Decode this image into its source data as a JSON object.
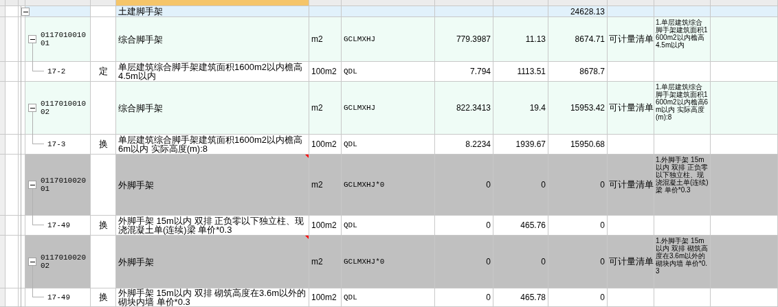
{
  "header_cells": [
    {
      "selected": false
    },
    {
      "selected": false
    },
    {
      "selected": false
    },
    {
      "selected": false
    },
    {
      "selected": false
    },
    {
      "selected": true
    },
    {
      "selected": false
    },
    {
      "selected": false
    },
    {
      "selected": false
    },
    {
      "selected": false
    },
    {
      "selected": false
    },
    {
      "selected": false
    },
    {
      "selected": false
    },
    {
      "selected": false
    }
  ],
  "rows": [
    {
      "kind": "section",
      "greyed": false,
      "flagged": false,
      "expanded": true,
      "code": "",
      "type": "",
      "name": "土建脚手架",
      "unit": "",
      "expr": "",
      "qty": "",
      "price": "",
      "total": "24628.13",
      "category": "",
      "features": ""
    },
    {
      "kind": "item",
      "greyed": false,
      "flagged": false,
      "expanded": true,
      "code": "011701001001",
      "type": "",
      "name": "综合脚手架",
      "unit": "m2",
      "expr": "GCLMXHJ",
      "qty": "779.3987",
      "price": "11.13",
      "total": "8674.71",
      "category": "可计量清单",
      "features": "1.单层建筑综合脚手架建筑面积1600m2以内檐高4.5m以内"
    },
    {
      "kind": "sub",
      "greyed": false,
      "flagged": false,
      "code": "17-2",
      "type": "定",
      "name": "单层建筑综合脚手架建筑面积1600m2以内檐高4.5m以内",
      "unit": "100m2",
      "expr": "QDL",
      "qty": "7.794",
      "price": "1113.51",
      "total": "8678.7",
      "category": "",
      "features": ""
    },
    {
      "kind": "item",
      "greyed": false,
      "flagged": false,
      "expanded": true,
      "code": "011701001002",
      "type": "",
      "name": "综合脚手架",
      "unit": "m2",
      "expr": "GCLMXHJ",
      "qty": "822.3413",
      "price": "19.4",
      "total": "15953.42",
      "category": "可计量清单",
      "features": "1.单层建筑综合脚手架建筑面积1600m2以内檐高6m以内 实际高度(m):8"
    },
    {
      "kind": "sub",
      "greyed": false,
      "flagged": false,
      "code": "17-3",
      "type": "换",
      "name": "单层建筑综合脚手架建筑面积1600m2以内檐高6m以内 实际高度(m):8",
      "unit": "100m2",
      "expr": "QDL",
      "qty": "8.2234",
      "price": "1939.67",
      "total": "15950.68",
      "category": "",
      "features": ""
    },
    {
      "kind": "item",
      "greyed": true,
      "flagged": true,
      "expanded": true,
      "code": "011701002001",
      "type": "",
      "name": "外脚手架",
      "unit": "m2",
      "expr": "GCLMXHJ*0",
      "qty": "0",
      "price": "0",
      "total": "0",
      "category": "可计量清单",
      "features": "1.外脚手架 15m以内 双排  正负零以下独立柱、现浇混凝土单(连续)梁 单价*0.3"
    },
    {
      "kind": "sub",
      "greyed": false,
      "flagged": false,
      "code": "17-49",
      "type": "换",
      "name": "外脚手架 15m以内 双排  正负零以下独立柱、现浇混凝土单(连续)梁 单价*0.3",
      "unit": "100m2",
      "expr": "QDL",
      "qty": "0",
      "price": "465.76",
      "total": "0",
      "category": "",
      "features": ""
    },
    {
      "kind": "item",
      "greyed": true,
      "flagged": true,
      "expanded": true,
      "code": "011701002002",
      "type": "",
      "name": "外脚手架",
      "unit": "m2",
      "expr": "GCLMXHJ*0",
      "qty": "0",
      "price": "0",
      "total": "0",
      "category": "可计量清单",
      "features": "1.外脚手架 15m以内 双排  砌筑高度在3.6m以外的砌块内墙 单价*0.3"
    },
    {
      "kind": "sub",
      "greyed": false,
      "flagged": false,
      "code": "17-49",
      "type": "换",
      "name": "外脚手架 15m以内 双排  砌筑高度在3.6m以外的砌块内墙 单价*0.3",
      "unit": "100m2",
      "expr": "QDL",
      "qty": "0",
      "price": "465.78",
      "total": "0",
      "category": "",
      "features": ""
    }
  ]
}
